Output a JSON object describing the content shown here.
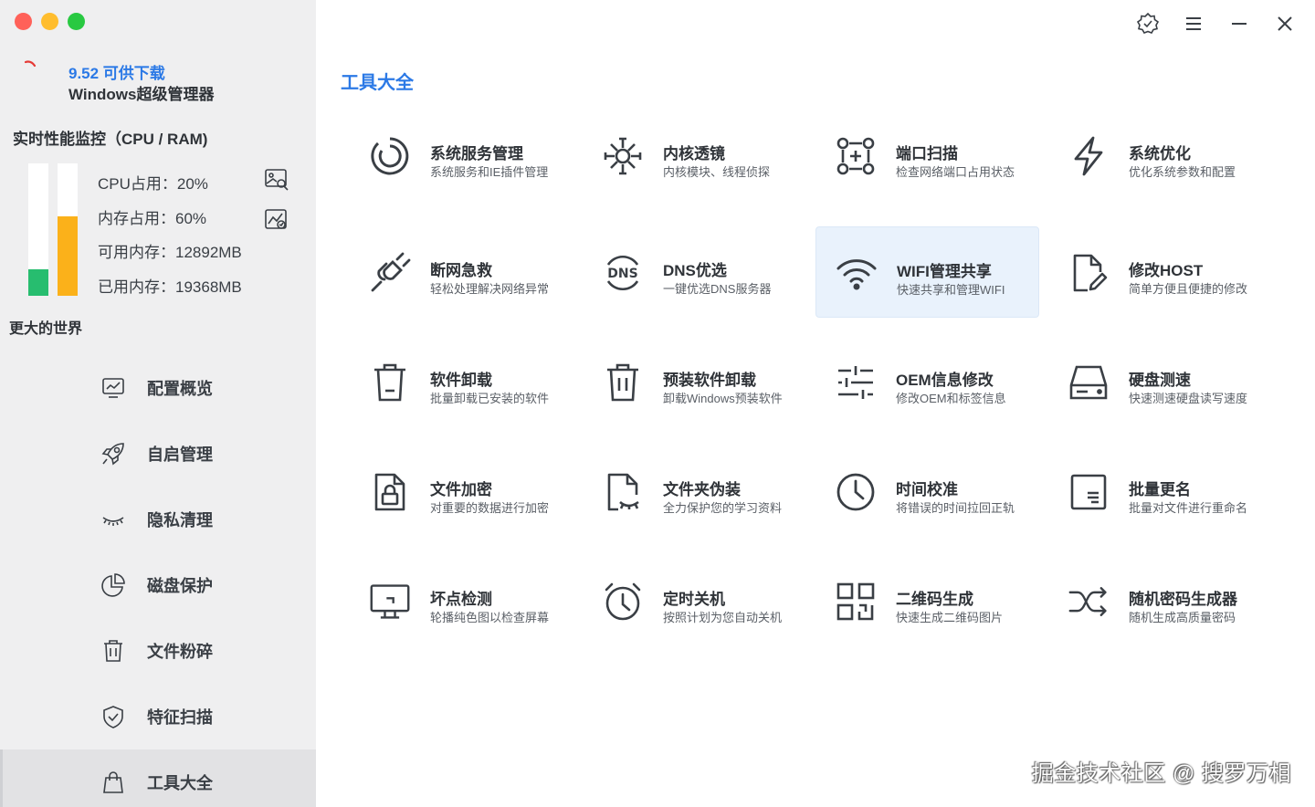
{
  "window": {
    "brand_version": "9.52 可供下载",
    "brand_name": "Windows超级管理器",
    "colors": {
      "accent": "#2b79e6",
      "cpu": "#27bd6f",
      "ram": "#fbb11a",
      "sidebar_bg": "#efeff0",
      "highlight": "#e9f2fc"
    }
  },
  "monitor": {
    "title": "实时性能监控（CPU / RAM)",
    "cpu_label": "CPU占用：20%",
    "ram_label": "内存占用：60%",
    "free_label": "可用内存：12892MB",
    "used_label": "已用内存：19368MB",
    "cpu_percent": 20,
    "ram_percent": 60
  },
  "sidebar": {
    "section_title": "更大的世界",
    "items": [
      {
        "label": "配置概览",
        "icon": "monitor-chart-icon"
      },
      {
        "label": "自启管理",
        "icon": "rocket-icon"
      },
      {
        "label": "隐私清理",
        "icon": "eye-closed-icon"
      },
      {
        "label": "磁盘保护",
        "icon": "pie-chart-icon"
      },
      {
        "label": "文件粉碎",
        "icon": "trash-icon"
      },
      {
        "label": "特征扫描",
        "icon": "shield-check-icon"
      },
      {
        "label": "工具大全",
        "icon": "bag-icon",
        "active": true
      }
    ]
  },
  "main": {
    "title": "工具大全",
    "tools": [
      {
        "name": "系统服务管理",
        "desc": "系统服务和IE插件管理",
        "icon": "service-icon"
      },
      {
        "name": "内核透镜",
        "desc": "内核模块、线程侦探",
        "icon": "kernel-icon"
      },
      {
        "name": "端口扫描",
        "desc": "检查网络端口占用状态",
        "icon": "port-scan-icon"
      },
      {
        "name": "系统优化",
        "desc": "优化系统参数和配置",
        "icon": "lightning-icon"
      },
      {
        "name": "断网急救",
        "desc": "轻松处理解决网络异常",
        "icon": "plug-icon"
      },
      {
        "name": "DNS优选",
        "desc": "一键优选DNS服务器",
        "icon": "dns-icon"
      },
      {
        "name": "WIFI管理共享",
        "desc": "快速共享和管理WIFI",
        "icon": "wifi-icon"
      },
      {
        "name": "修改HOST",
        "desc": "简单方便且便捷的修改",
        "icon": "file-edit-icon"
      },
      {
        "name": "软件卸载",
        "desc": "批量卸载已安装的软件",
        "icon": "trash-minus-icon"
      },
      {
        "name": "预装软件卸载",
        "desc": "卸载Windows预装软件",
        "icon": "trash-pause-icon"
      },
      {
        "name": "OEM信息修改",
        "desc": "修改OEM和标签信息",
        "icon": "sliders-icon"
      },
      {
        "name": "硬盘测速",
        "desc": "快速测速硬盘读写速度",
        "icon": "hard-drive-icon"
      },
      {
        "name": "文件加密",
        "desc": "对重要的数据进行加密",
        "icon": "file-lock-icon"
      },
      {
        "name": "文件夹伪装",
        "desc": "全力保护您的学习资料",
        "icon": "file-mask-icon"
      },
      {
        "name": "时间校准",
        "desc": "将错误的时间拉回正轨",
        "icon": "clock-icon"
      },
      {
        "name": "批量更名",
        "desc": "批量对文件进行重命名",
        "icon": "rename-icon"
      },
      {
        "name": "坏点检测",
        "desc": "轮播纯色图以检查屏幕",
        "icon": "screen-icon"
      },
      {
        "name": "定时关机",
        "desc": "按照计划为您自动关机",
        "icon": "alarm-icon"
      },
      {
        "name": "二维码生成",
        "desc": "快速生成二维码图片",
        "icon": "qrcode-icon"
      },
      {
        "name": "随机密码生成器",
        "desc": "随机生成高质量密码",
        "icon": "shuffle-icon"
      }
    ]
  },
  "watermark": "掘金技术社区 @ 搜罗万相"
}
